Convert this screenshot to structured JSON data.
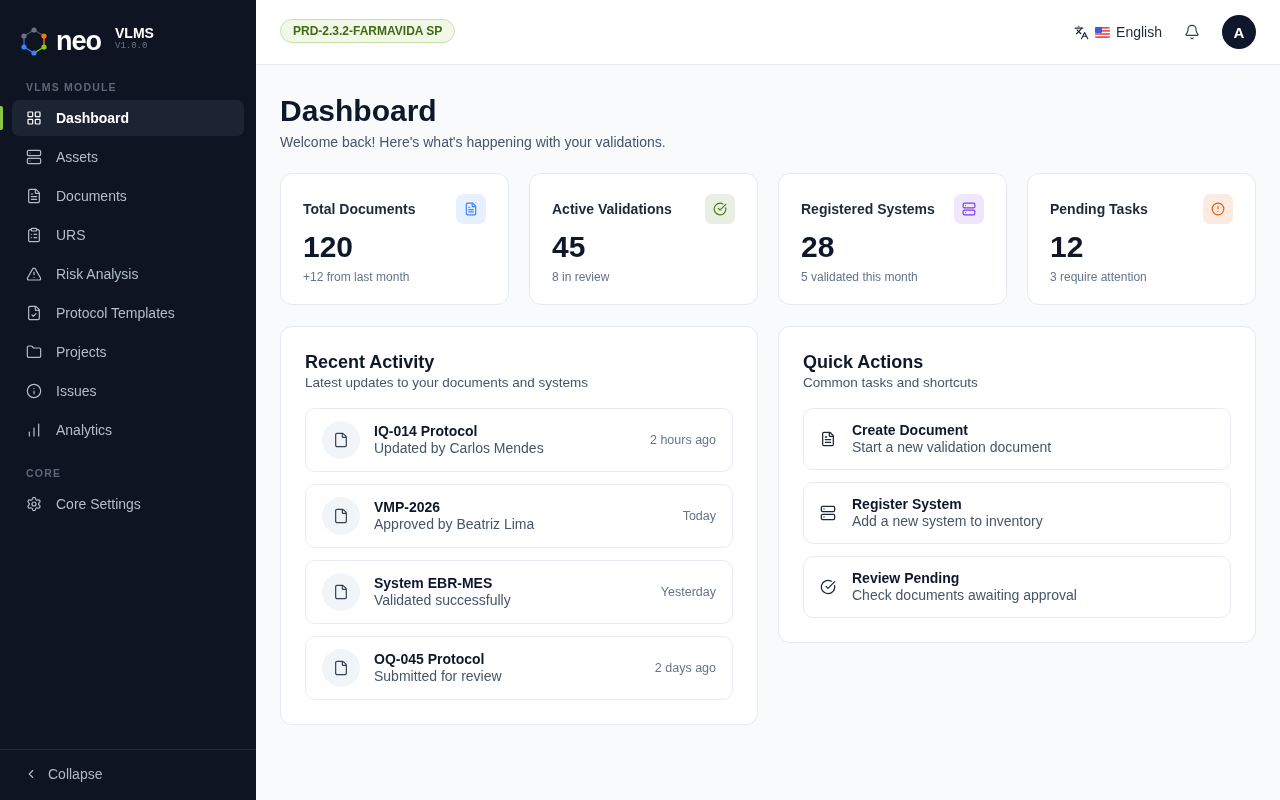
{
  "brand": {
    "name": "neo",
    "product": "VLMS",
    "version": "V1.0.0"
  },
  "sidebar": {
    "sections": [
      {
        "label": "VLMS MODULE",
        "items": [
          {
            "label": "Dashboard",
            "selected": true
          },
          {
            "label": "Assets",
            "selected": false
          },
          {
            "label": "Documents",
            "selected": false
          },
          {
            "label": "URS",
            "selected": false
          },
          {
            "label": "Risk Analysis",
            "selected": false
          },
          {
            "label": "Protocol Templates",
            "selected": false
          },
          {
            "label": "Projects",
            "selected": false
          },
          {
            "label": "Issues",
            "selected": false
          },
          {
            "label": "Analytics",
            "selected": false
          }
        ]
      },
      {
        "label": "CORE",
        "items": [
          {
            "label": "Core Settings",
            "selected": false
          }
        ]
      }
    ],
    "collapse": "Collapse"
  },
  "header": {
    "environment": "PRD-2.3.2-FARMAVIDA SP",
    "language": "English",
    "avatar": "A"
  },
  "page": {
    "title": "Dashboard",
    "subtitle": "Welcome back! Here's what's happening with your validations."
  },
  "stats": [
    {
      "title": "Total Documents",
      "value": "120",
      "note": "+12 from last month",
      "color": "#3b82f6"
    },
    {
      "title": "Active Validations",
      "value": "45",
      "note": "8 in review",
      "color": "#4d7c0f"
    },
    {
      "title": "Registered Systems",
      "value": "28",
      "note": "5 validated this month",
      "color": "#7c3aed"
    },
    {
      "title": "Pending Tasks",
      "value": "12",
      "note": "3 require attention",
      "color": "#ea580c"
    }
  ],
  "recent_activity": {
    "title": "Recent Activity",
    "subtitle": "Latest updates to your documents and systems",
    "items": [
      {
        "title": "IQ-014 Protocol",
        "detail": "Updated by Carlos Mendes",
        "time": "2 hours ago"
      },
      {
        "title": "VMP-2026",
        "detail": "Approved by Beatriz Lima",
        "time": "Today"
      },
      {
        "title": "System EBR-MES",
        "detail": "Validated successfully",
        "time": "Yesterday"
      },
      {
        "title": "OQ-045 Protocol",
        "detail": "Submitted for review",
        "time": "2 days ago"
      }
    ]
  },
  "quick_actions": {
    "title": "Quick Actions",
    "subtitle": "Common tasks and shortcuts",
    "items": [
      {
        "title": "Create Document",
        "description": "Start a new validation document"
      },
      {
        "title": "Register System",
        "description": "Add a new system to inventory"
      },
      {
        "title": "Review Pending",
        "description": "Check documents awaiting approval"
      }
    ]
  }
}
